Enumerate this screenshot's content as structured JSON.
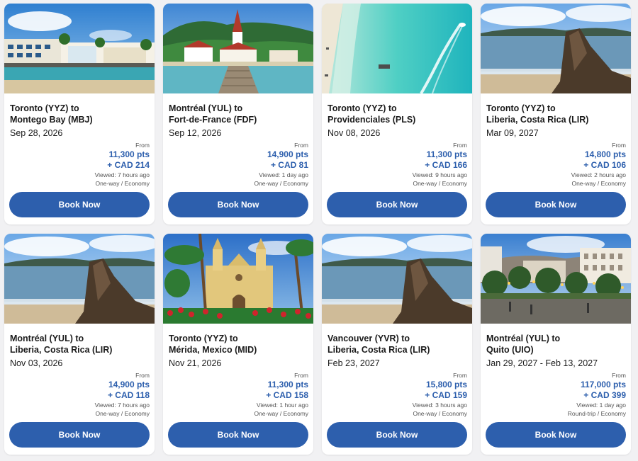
{
  "colors": {
    "accent": "#2d5fad",
    "text": "#1a1a1a",
    "muted": "#555555"
  },
  "deals": [
    {
      "route": "Toronto (YYZ) to\nMontego Bay (MBJ)",
      "date": "Sep 28, 2026",
      "from": "From",
      "points": "11,300 pts",
      "cash": "+ CAD 214",
      "viewed": "Viewed: 7 hours ago",
      "trip": "One-way / Economy",
      "button": "Book Now",
      "photo": "waterfront-resort"
    },
    {
      "route": "Montréal (YUL) to\nFort-de-France (FDF)",
      "date": "Sep 12, 2026",
      "from": "From",
      "points": "14,900 pts",
      "cash": "+ CAD 81",
      "viewed": "Viewed: 1 day ago",
      "trip": "One-way / Economy",
      "button": "Book Now",
      "photo": "church-pier"
    },
    {
      "route": "Toronto (YYZ) to\nProvidenciales (PLS)",
      "date": "Nov 08, 2026",
      "from": "From",
      "points": "11,300 pts",
      "cash": "+ CAD 166",
      "viewed": "Viewed: 9 hours ago",
      "trip": "One-way / Economy",
      "button": "Book Now",
      "photo": "turquoise-beach"
    },
    {
      "route": "Toronto (YYZ) to\nLiberia, Costa Rica (LIR)",
      "date": "Mar 09, 2027",
      "from": "From",
      "points": "14,800 pts",
      "cash": "+ CAD 106",
      "viewed": "Viewed: 2 hours ago",
      "trip": "One-way / Economy",
      "button": "Book Now",
      "photo": "rock-beach"
    },
    {
      "route": "Montréal (YUL) to\nLiberia, Costa Rica (LIR)",
      "date": "Nov 03, 2026",
      "from": "From",
      "points": "14,900 pts",
      "cash": "+ CAD 118",
      "viewed": "Viewed: 7 hours ago",
      "trip": "One-way / Economy",
      "button": "Book Now",
      "photo": "rock-beach"
    },
    {
      "route": "Toronto (YYZ) to\nMérida, Mexico (MID)",
      "date": "Nov 21, 2026",
      "from": "From",
      "points": "11,300 pts",
      "cash": "+ CAD 158",
      "viewed": "Viewed: 1 hour ago",
      "trip": "One-way / Economy",
      "button": "Book Now",
      "photo": "yellow-church"
    },
    {
      "route": "Vancouver (YVR) to\nLiberia, Costa Rica (LIR)",
      "date": "Feb 23, 2027",
      "from": "From",
      "points": "15,800 pts",
      "cash": "+ CAD 159",
      "viewed": "Viewed: 3 hours ago",
      "trip": "One-way / Economy",
      "button": "Book Now",
      "photo": "rock-beach"
    },
    {
      "route": "Montréal (YUL) to\nQuito (UIO)",
      "date": "Jan 29, 2027 - Feb 13, 2027",
      "from": "From",
      "points": "117,000 pts",
      "cash": "+ CAD 399",
      "viewed": "Viewed: 1 day ago",
      "trip": "Round-trip / Economy",
      "button": "Book Now",
      "photo": "city-plaza"
    }
  ]
}
